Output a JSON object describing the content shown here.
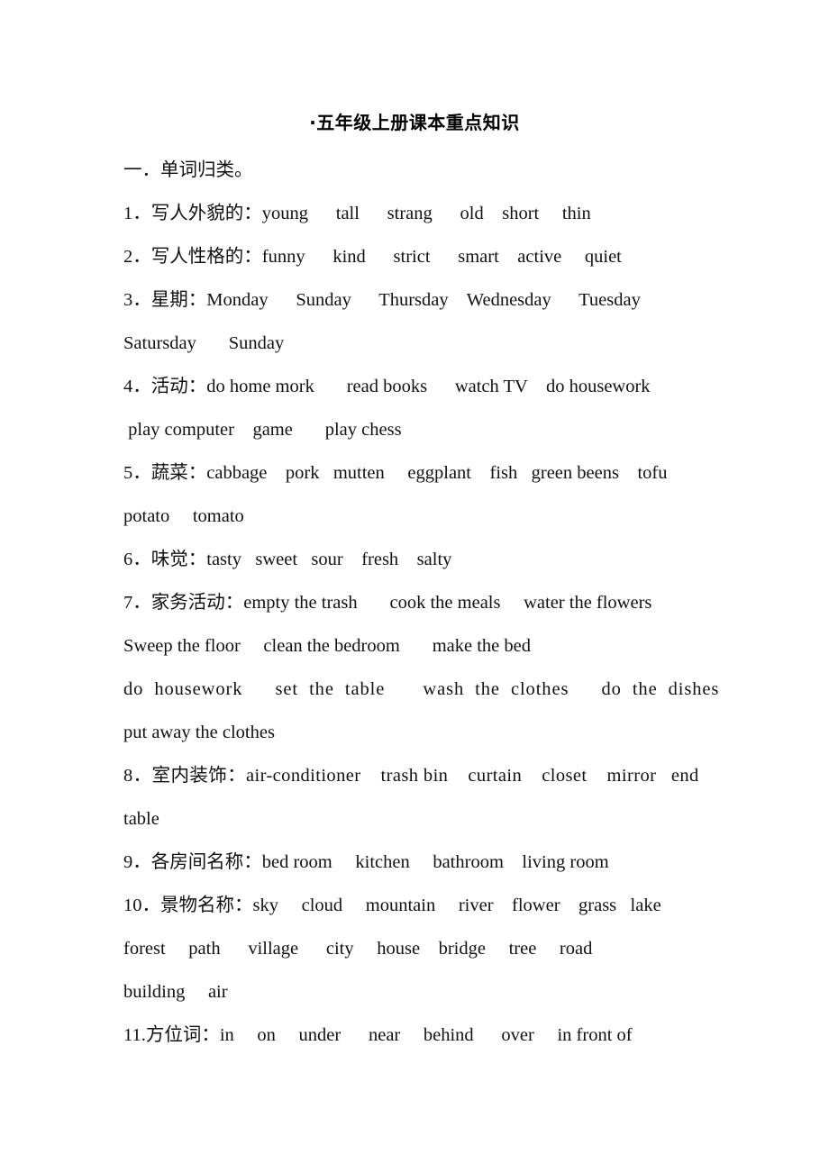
{
  "document": {
    "title": "·五年级上册课本重点知识",
    "section_heading": "一．单词归类。",
    "lines": [
      {
        "id": "item-1",
        "text": "1．写人外貌的：young      tall      strang      old    short     thin"
      },
      {
        "id": "item-2",
        "text": "2．写人性格的：funny      kind      strict      smart    active     quiet"
      },
      {
        "id": "item-3",
        "text": "3．星期：Monday      Sunday      Thursday    Wednesday      Tuesday"
      },
      {
        "id": "item-3-cont",
        "text": "Satursday       Sunday"
      },
      {
        "id": "item-4",
        "text": "4．活动：do home mork       read books      watch TV    do housework"
      },
      {
        "id": "item-4-cont",
        "text": " play computer    game       play chess"
      },
      {
        "id": "item-5",
        "text": "5．蔬菜：cabbage    pork   mutten     eggplant    fish   green beens    tofu"
      },
      {
        "id": "item-5-cont",
        "text": "potato     tomato"
      },
      {
        "id": "item-6",
        "text": "6．味觉：tasty   sweet     fresh     salty"
      },
      {
        "id": "item-7",
        "text": "7．家务活动：empty the trash       cook the meals     water the flowers"
      },
      {
        "id": "item-7-cont-1",
        "text": "Sweep the floor     clean the bedroom       make the bed"
      },
      {
        "id": "item-7-cont-2",
        "text": "do  housework      set  the  table       wash  the  clothes      do  the  dishes"
      },
      {
        "id": "item-7-cont-3",
        "text": "put away the clothes"
      },
      {
        "id": "item-8",
        "text": "8．室内装饰：air-conditioner    trash bin    curtain    closet    mirror   end"
      },
      {
        "id": "item-8-cont",
        "text": "table"
      },
      {
        "id": "item-9",
        "text": "9．各房间名称：bed room     kitchen     bathroom    living room"
      },
      {
        "id": "item-10",
        "text": "10．景物名称：sky     cloud     mountain     river    flower    grass   lake"
      },
      {
        "id": "item-10-cont-1",
        "text": "forest     path      village      city     house    bridge     tree     road"
      },
      {
        "id": "item-10-cont-2",
        "text": "building     air"
      },
      {
        "id": "item-11",
        "text": "11.方位词：in     on     under      near     behind      over     in front of"
      }
    ],
    "item_6_full": "6．味觉：tasty   sweet   sour    fresh    salty"
  }
}
